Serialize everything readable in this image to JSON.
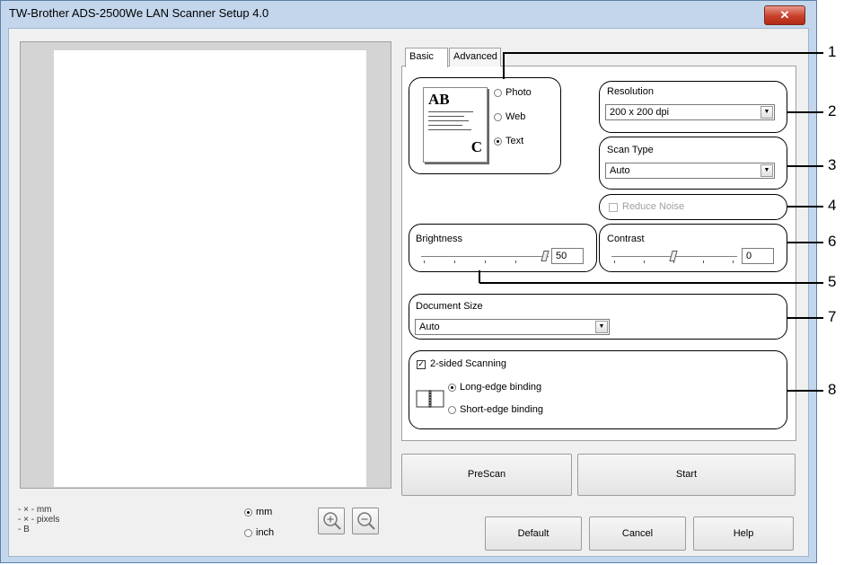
{
  "window": {
    "title": "TW-Brother ADS-2500We LAN Scanner Setup 4.0",
    "close_icon": "close-icon"
  },
  "preview_info": {
    "mm_line": "- × - mm",
    "pixels_line": "- × - pixels",
    "b_line": "- B"
  },
  "units": {
    "mm_label": "mm",
    "inch_label": "inch",
    "selected": "mm"
  },
  "tabs": [
    {
      "label": "Basic",
      "active": true
    },
    {
      "label": "Advanced",
      "active": false
    }
  ],
  "image_type": {
    "icon_text_top": "AB",
    "icon_text_bottom": "C",
    "options": [
      "Photo",
      "Web",
      "Text"
    ],
    "selected": "Text"
  },
  "resolution": {
    "label": "Resolution",
    "value": "200 x 200 dpi"
  },
  "scan_type": {
    "label": "Scan Type",
    "value": "Auto"
  },
  "reduce_noise": {
    "label": "Reduce Noise",
    "checked": false,
    "enabled": false
  },
  "brightness": {
    "label": "Brightness",
    "value": "50"
  },
  "contrast": {
    "label": "Contrast",
    "value": "0"
  },
  "document_size": {
    "label": "Document Size",
    "value": "Auto"
  },
  "duplex": {
    "label": "2-sided Scanning",
    "checked": true,
    "long_edge": "Long-edge binding",
    "short_edge": "Short-edge binding",
    "selected": "long"
  },
  "buttons": {
    "prescan": "PreScan",
    "start": "Start",
    "default": "Default",
    "cancel": "Cancel",
    "help": "Help"
  },
  "callouts": [
    "1",
    "2",
    "3",
    "4",
    "5",
    "6",
    "7",
    "8"
  ]
}
